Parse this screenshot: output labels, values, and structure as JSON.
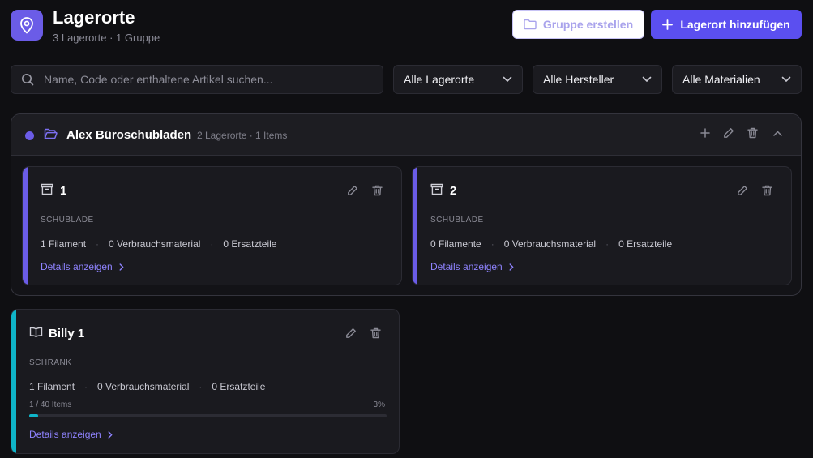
{
  "header": {
    "title": "Lagerorte",
    "subtitle": "3 Lagerorte · 1 Gruppe",
    "create_group_label": "Gruppe erstellen",
    "add_location_label": "Lagerort hinzufügen"
  },
  "filters": {
    "search_placeholder": "Name, Code oder enthaltene Artikel suchen...",
    "location_select": "Alle Lagerorte",
    "manufacturer_select": "Alle Hersteller",
    "material_select": "Alle Materialien"
  },
  "group": {
    "name": "Alex Büroschubladen",
    "meta": "2 Lagerorte · 1 Items",
    "color": "#6b5ce7",
    "cards": [
      {
        "title": "1",
        "type": "SCHUBLADE",
        "stats": [
          "1 Filament",
          "0 Verbrauchsmaterial",
          "0 Ersatzteile"
        ],
        "details": "Details anzeigen",
        "icon": "archive-box-icon",
        "color": "#6b5ce7"
      },
      {
        "title": "2",
        "type": "SCHUBLADE",
        "stats": [
          "0 Filamente",
          "0 Verbrauchsmaterial",
          "0 Ersatzteile"
        ],
        "details": "Details anzeigen",
        "icon": "archive-box-icon",
        "color": "#6b5ce7"
      }
    ]
  },
  "standalone": {
    "title": "Billy 1",
    "type": "SCHRANK",
    "stats": [
      "1 Filament",
      "0 Verbrauchsmaterial",
      "0 Ersatzteile"
    ],
    "capacity_label": "1 / 40 Items",
    "percent_label": "3%",
    "progress_fraction": 0.025,
    "details": "Details anzeigen",
    "icon": "open-book-icon",
    "color": "#0fb5c9"
  },
  "colors": {
    "accent": "#5b4ff0",
    "link": "#8f83ff",
    "cyan": "#0fb5c9"
  }
}
